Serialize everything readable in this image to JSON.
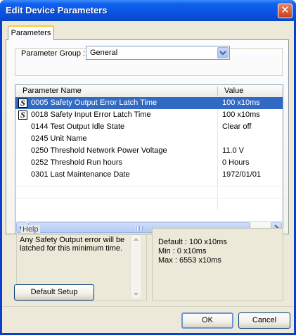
{
  "window": {
    "title": "Edit Device Parameters",
    "close_glyph": "✕"
  },
  "tabs": [
    {
      "label": "Parameters",
      "active": true
    }
  ],
  "parameter_group": {
    "label": "Parameter Group :",
    "value": "General"
  },
  "grid": {
    "columns": [
      "Parameter Name",
      "Value"
    ],
    "rows": [
      {
        "safety": true,
        "name": "0005 Safety Output Error Latch Time",
        "value": "100 x10ms",
        "selected": true
      },
      {
        "safety": true,
        "name": "0018 Safety Input Error Latch Time",
        "value": "100 x10ms",
        "selected": false
      },
      {
        "safety": false,
        "name": "0144 Test Output Idle State",
        "value": "Clear off",
        "selected": false
      },
      {
        "safety": false,
        "name": "0245 Unit Name",
        "value": "",
        "selected": false
      },
      {
        "safety": false,
        "name": "0250 Threshold Network Power Voltage",
        "value": "11.0 V",
        "selected": false
      },
      {
        "safety": false,
        "name": "0252 Threshold Run hours",
        "value": "0 Hours",
        "selected": false
      },
      {
        "safety": false,
        "name": "0301 Last Maintenance Date",
        "value": "1972/01/01",
        "selected": false
      }
    ],
    "safety_icon_glyph": "S"
  },
  "help": {
    "legend": "Help",
    "text": "Any Safety Output error will be latched for this minimum time."
  },
  "info": {
    "default": "Default : 100 x10ms",
    "min": "Min : 0 x10ms",
    "max": "Max : 6553 x10ms"
  },
  "buttons": {
    "default_setup": "Default Setup",
    "ok": "OK",
    "cancel": "Cancel"
  },
  "colors": {
    "title_bar": "#0a53e2",
    "selection": "#316ac5",
    "dialog_face": "#ece9d8",
    "help_legend": "#1f4ec0"
  }
}
